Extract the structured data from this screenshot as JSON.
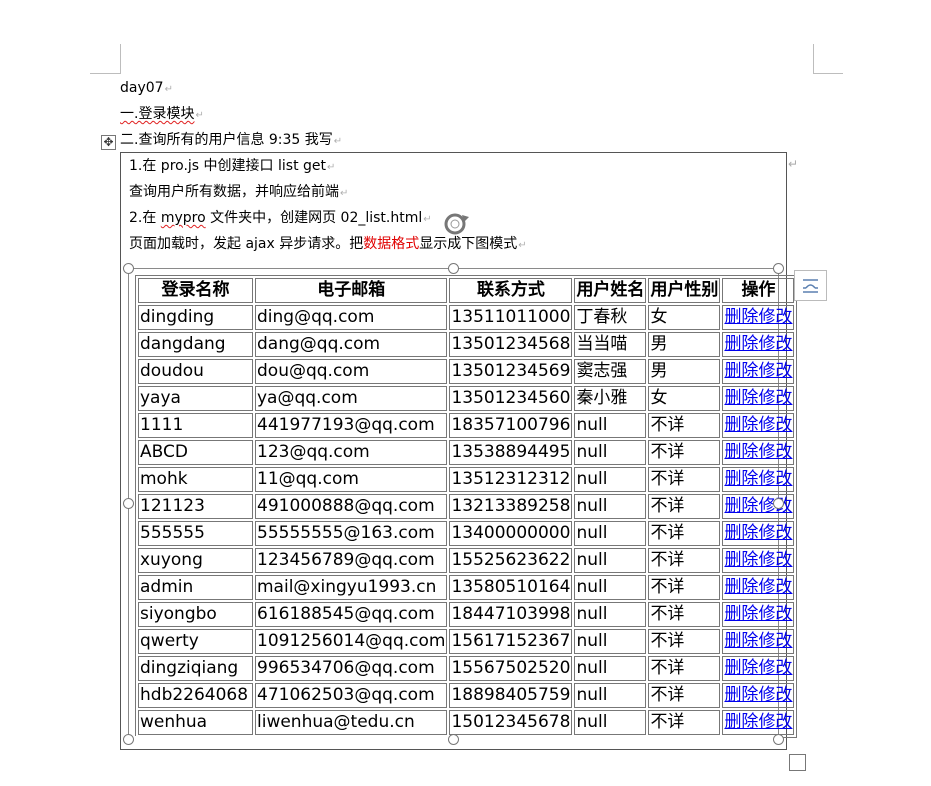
{
  "doc": {
    "lines": [
      {
        "text": "day07"
      },
      {
        "text": "一.登录模块"
      },
      {
        "text": "二.查询所有的用户信息 9:35 我写"
      }
    ],
    "frame_lines": {
      "l1": "1.在 pro.js 中创建接口 list    get",
      "l2": "查询用户所有数据，并响应给前端",
      "l3_pre": "2.在 ",
      "l3_squig": "mypro",
      "l3_post": " 文件夹中，创建网页 02_list.html",
      "l4_pre": "页面加载时，发起 ajax 异步请求。把",
      "l4_red": "数据格式",
      "l4_post": "显示成下图模式"
    }
  },
  "table": {
    "headers": [
      "登录名称",
      "电子邮箱",
      "联系方式",
      "用户姓名",
      "用户性别",
      "操作"
    ],
    "rows": [
      [
        "dingding",
        "ding@qq.com",
        "13511011000",
        "丁春秋",
        "女"
      ],
      [
        "dangdang",
        "dang@qq.com",
        "13501234568",
        "当当喵",
        "男"
      ],
      [
        "doudou",
        "dou@qq.com",
        "13501234569",
        "窦志强",
        "男"
      ],
      [
        "yaya",
        "ya@qq.com",
        "13501234560",
        "秦小雅",
        "女"
      ],
      [
        "1111",
        "441977193@qq.com",
        "18357100796",
        "null",
        "不详"
      ],
      [
        "ABCD",
        "123@qq.com",
        "13538894495",
        "null",
        "不详"
      ],
      [
        "mohk",
        "11@qq.com",
        "13512312312",
        "null",
        "不详"
      ],
      [
        "121123",
        "491000888@qq.com",
        "13213389258",
        "null",
        "不详"
      ],
      [
        "555555",
        "55555555@163.com",
        "13400000000",
        "null",
        "不详"
      ],
      [
        "xuyong",
        "123456789@qq.com",
        "15525623622",
        "null",
        "不详"
      ],
      [
        "admin",
        "mail@xingyu1993.cn",
        "13580510164",
        "null",
        "不详"
      ],
      [
        "siyongbo",
        "616188545@qq.com",
        "18447103998",
        "null",
        "不详"
      ],
      [
        "qwerty",
        "1091256014@qq.com",
        "15617152367",
        "null",
        "不详"
      ],
      [
        "dingziqiang",
        "996534706@qq.com",
        "15567502520",
        "null",
        "不详"
      ],
      [
        "hdb2264068",
        "471062503@qq.com",
        "18898405759",
        "null",
        "不详"
      ],
      [
        "wenhua",
        "liwenhua@tedu.cn",
        "15012345678",
        "null",
        "不详"
      ]
    ],
    "action_delete": "删除",
    "action_edit": "修改"
  },
  "icons": {
    "move": "move-icon",
    "rotate": "rotate-icon",
    "layout": "layout-options-icon"
  },
  "colors": {
    "link": "#0000ee",
    "highlight_red": "#e00000"
  }
}
